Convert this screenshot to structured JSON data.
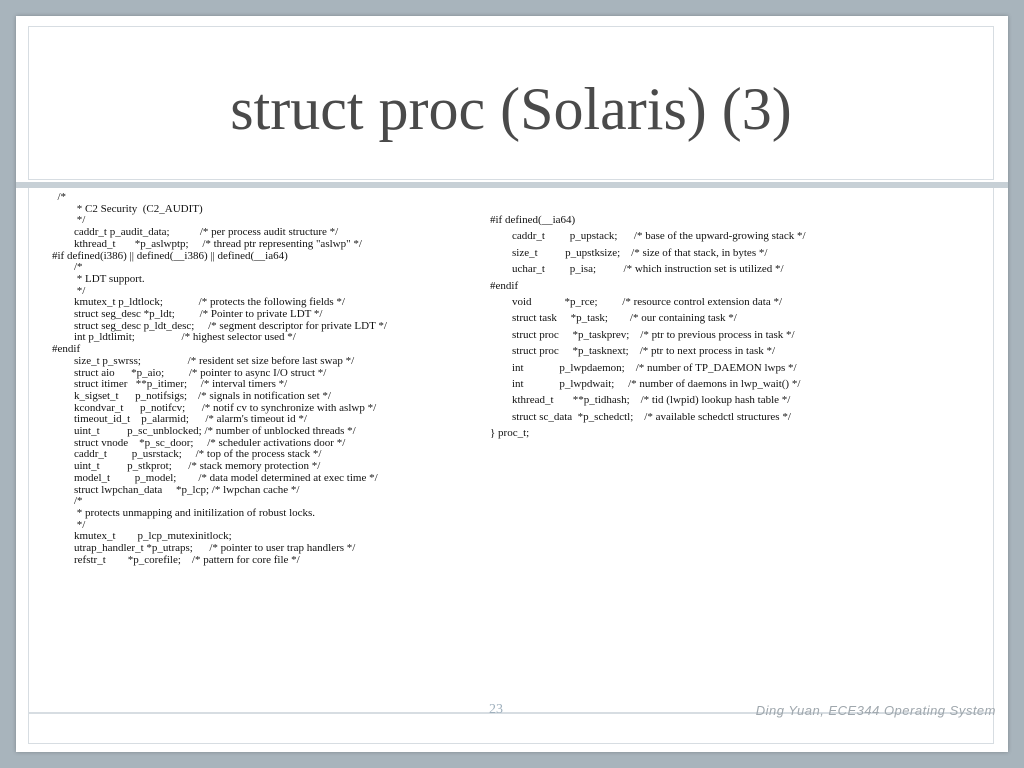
{
  "slide": {
    "title": "struct proc (Solaris) (3)",
    "page_number": "23",
    "credit": "Ding Yuan, ECE344 Operating System"
  },
  "code": {
    "left": "  /*\n         * C2 Security  (C2_AUDIT)\n         */\n        caddr_t p_audit_data;           /* per process audit structure */\n        kthread_t       *p_aslwptp;     /* thread ptr representing \"aslwp\" */\n#if defined(i386) || defined(__i386) || defined(__ia64)\n        /*\n         * LDT support.\n         */\n        kmutex_t p_ldtlock;             /* protects the following fields */\n        struct seg_desc *p_ldt;         /* Pointer to private LDT */\n        struct seg_desc p_ldt_desc;     /* segment descriptor for private LDT */\n        int p_ldtlimit;                 /* highest selector used */\n#endif\n        size_t p_swrss;                 /* resident set size before last swap */\n        struct aio      *p_aio;         /* pointer to async I/O struct */\n        struct itimer   **p_itimer;     /* interval timers */\n        k_sigset_t      p_notifsigs;    /* signals in notification set */\n        kcondvar_t      p_notifcv;      /* notif cv to synchronize with aslwp */\n        timeout_id_t    p_alarmid;      /* alarm's timeout id */\n        uint_t          p_sc_unblocked; /* number of unblocked threads */\n        struct vnode    *p_sc_door;     /* scheduler activations door */\n        caddr_t         p_usrstack;     /* top of the process stack */\n        uint_t          p_stkprot;      /* stack memory protection */\n        model_t         p_model;        /* data model determined at exec time */\n        struct lwpchan_data     *p_lcp; /* lwpchan cache */\n        /*\n         * protects unmapping and initilization of robust locks.\n         */\n        kmutex_t        p_lcp_mutexinitlock;\n        utrap_handler_t *p_utraps;      /* pointer to user trap handlers */\n        refstr_t        *p_corefile;    /* pattern for core file */",
    "right": "#if defined(__ia64)\n        caddr_t         p_upstack;      /* base of the upward-growing stack */\n        size_t          p_upstksize;    /* size of that stack, in bytes */\n        uchar_t         p_isa;          /* which instruction set is utilized */\n#endif\n        void            *p_rce;         /* resource control extension data */\n        struct task     *p_task;        /* our containing task */\n        struct proc     *p_taskprev;    /* ptr to previous process in task */\n        struct proc     *p_tasknext;    /* ptr to next process in task */\n        int             p_lwpdaemon;    /* number of TP_DAEMON lwps */\n        int             p_lwpdwait;     /* number of daemons in lwp_wait() */\n        kthread_t       **p_tidhash;    /* tid (lwpid) lookup hash table */\n        struct sc_data  *p_schedctl;    /* available schedctl structures */\n} proc_t;"
  }
}
